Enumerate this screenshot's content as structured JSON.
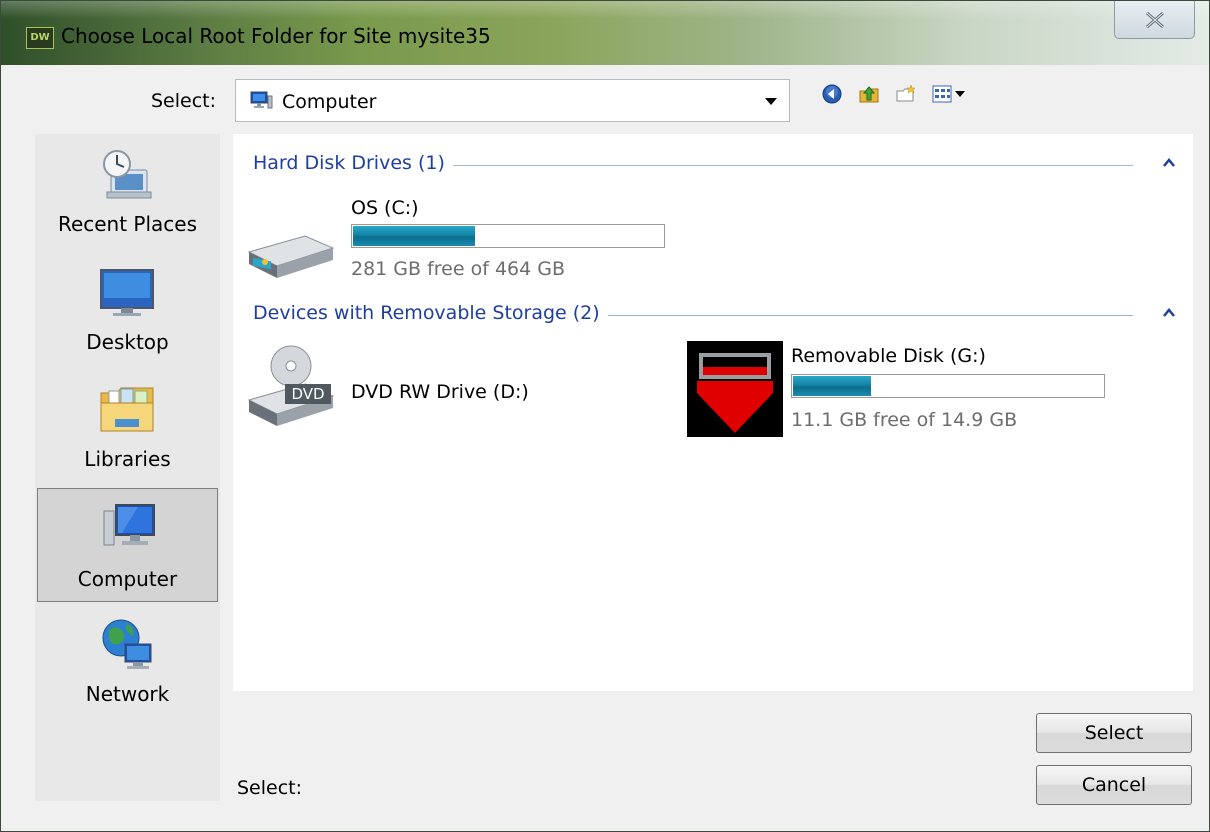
{
  "window": {
    "app_icon_text": "DW",
    "title": "Choose Local Root Folder for Site mysite35"
  },
  "toolbar": {
    "look_in_label": "Select:",
    "location": "Computer",
    "buttons": [
      "back-icon",
      "up-folder-icon",
      "new-folder-icon",
      "views-menu-icon"
    ]
  },
  "places": [
    {
      "label": "Recent Places",
      "icon": "recent-places-icon",
      "selected": false
    },
    {
      "label": "Desktop",
      "icon": "desktop-icon",
      "selected": false
    },
    {
      "label": "Libraries",
      "icon": "libraries-icon",
      "selected": false
    },
    {
      "label": "Computer",
      "icon": "computer-icon",
      "selected": true
    },
    {
      "label": "Network",
      "icon": "network-icon",
      "selected": false
    }
  ],
  "groups": {
    "hard_disks": {
      "title": "Hard Disk Drives (1)",
      "items": [
        {
          "name": "OS (C:)",
          "free_text": "281 GB free of 464 GB",
          "used_fraction": 0.39
        }
      ]
    },
    "removable": {
      "title": "Devices with Removable Storage (2)",
      "items": [
        {
          "name": "DVD RW Drive (D:)",
          "icon_text": "DVD"
        },
        {
          "name": "Removable Disk (G:)",
          "free_text": "11.1 GB free of 14.9 GB",
          "used_fraction": 0.25
        }
      ]
    }
  },
  "footer": {
    "folder_label": "Select:",
    "select_button": "Select",
    "cancel_button": "Cancel"
  },
  "colors": {
    "group_title": "#1e3ea0",
    "progress_fill": "#1484a6",
    "removable_icon_red": "#e00000"
  }
}
